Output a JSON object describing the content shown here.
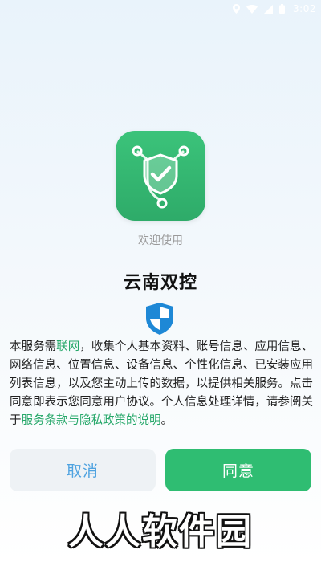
{
  "status_bar": {
    "time": "3:02",
    "icons": [
      "location-icon",
      "wifi-icon",
      "signal-icon",
      "battery-icon"
    ]
  },
  "app": {
    "icon": "shield-check-icon",
    "welcome_text": "欢迎使用",
    "name": "云南双控"
  },
  "notice": {
    "part1": "本服务需",
    "link1": "联网",
    "part2": "，收集个人基本资料、账号信息、应用信息、网络信息、位置信息、设备信息、个性化信息、已安装应用列表信息，以及您主动上传的数据，以提供相关服务。点击同意即表示您同意用户协议。个人信息处理详情，请参阅关于",
    "link2": "服务条款与隐私政策的说明",
    "part3": "。"
  },
  "buttons": {
    "cancel_label": "取消",
    "agree_label": "同意"
  },
  "watermark": {
    "text": "人人软件园"
  },
  "colors": {
    "accent_green": "#2fbd72",
    "link_green": "#27a86a",
    "cancel_text_blue": "#4fa3e0",
    "shield_blue": "#1e88d6"
  }
}
